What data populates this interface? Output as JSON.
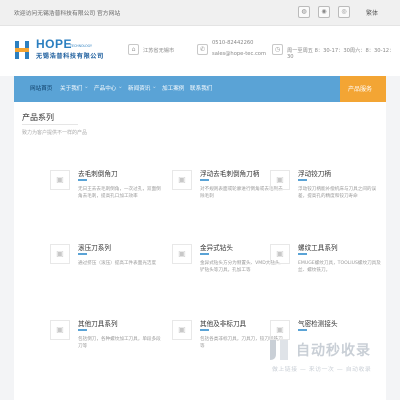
{
  "topbar": {
    "welcome": "欢迎访问无锡浩普科技有限公司 官方网站",
    "icons": [
      "weixin-icon",
      "weibo-icon",
      "qq-icon"
    ],
    "lang": "繁体"
  },
  "header": {
    "logo": {
      "brand": "HOPE",
      "tech": "TECHNOLOGY",
      "cn": "无锡浩普科技有限公司"
    },
    "location": "江苏省无锡市",
    "phone": "0510-82442260",
    "email": "sales@hope-tec.com",
    "hours": "周一至周五 8：30-17：30周六：8：30-12：30"
  },
  "nav": {
    "items": [
      "网站首页",
      "关于我们",
      "产品中心",
      "新闻资讯",
      "加工案例",
      "联系我们"
    ],
    "cta": "产品服务"
  },
  "section": {
    "title": "产品系列",
    "subtitle": "致力为客户提供不一样的产品"
  },
  "products": [
    {
      "title": "去毛刺倒角刀",
      "desc": "无日王去去毛刺倒角，一次过孔，双面倒角去毛刺，提高孔口加工效率"
    },
    {
      "title": "浮动去毛刺倒角刀柄",
      "desc": "对不规则表面或轮廓进行倒角或去毛刺去除毛刺"
    },
    {
      "title": "浮动铰刀柄",
      "desc": "浮动铰刀柄能补偿机床与刀具之间的误差，提高孔的精度和铰刀寿命"
    },
    {
      "title": "滚压刀系列",
      "desc": "通过挤压（滚压）提高工件表面光洁度"
    },
    {
      "title": "金异式钻头",
      "desc": "金异式钻头方分为侧置头、VMD大钻头、铲钻头等刀具，孔加工等"
    },
    {
      "title": "螺纹工具系列",
      "desc": "EMUGE螺纹刀具，TOOLIUS螺纹刀具及丝、螺纹铣刀。"
    },
    {
      "title": "其他刀具系列",
      "desc": "包括倒刀，各种螺纹加工刀具，单段多段刀等"
    },
    {
      "title": "其他及非标刀具",
      "desc": "包括各类非标刀具，刀具刀，铰刀和铣刀等"
    },
    {
      "title": "气密检测接头",
      "desc": ""
    }
  ],
  "watermark": {
    "big": "自动秒收录",
    "small": "做上链接 — 来访一次 — 自动收录"
  }
}
